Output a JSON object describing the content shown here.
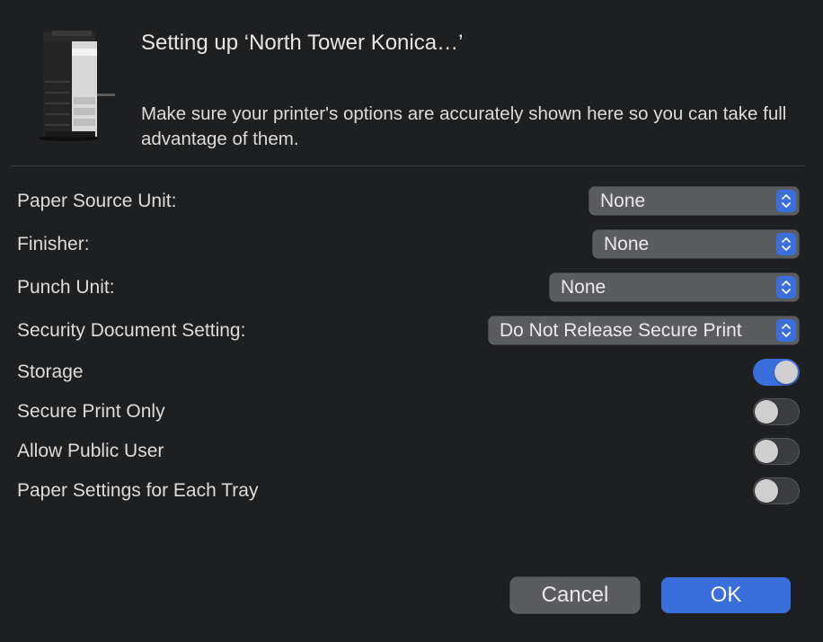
{
  "dialog": {
    "title": "Setting up ‘North Tower Konica…’",
    "description": "Make sure your printer's options are accurately shown here so you can take full advantage of them."
  },
  "options": {
    "paper_source_unit": {
      "label": "Paper Source Unit:",
      "value": "None"
    },
    "finisher": {
      "label": "Finisher:",
      "value": "None"
    },
    "punch_unit": {
      "label": "Punch Unit:",
      "value": "None"
    },
    "security_document_setting": {
      "label": "Security Document Setting:",
      "value": "Do Not Release Secure Print"
    }
  },
  "toggles": {
    "storage": {
      "label": "Storage",
      "on": true
    },
    "secure_print_only": {
      "label": "Secure Print Only",
      "on": false
    },
    "allow_public_user": {
      "label": "Allow Public User",
      "on": false
    },
    "paper_settings_each_tray": {
      "label": "Paper Settings for Each Tray",
      "on": false
    }
  },
  "buttons": {
    "cancel": "Cancel",
    "ok": "OK"
  },
  "colors": {
    "accent": "#3a6fdb",
    "background": "#1e1f21",
    "control": "#5b5c60"
  },
  "icons": {
    "printer": "printer-icon",
    "popup_arrows": "chevron-up-down-icon"
  }
}
